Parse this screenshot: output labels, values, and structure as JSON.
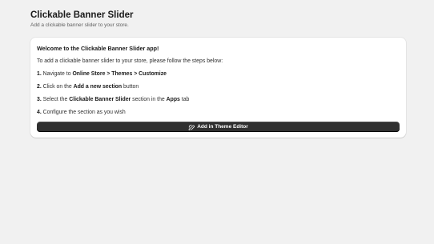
{
  "header": {
    "title": "Clickable Banner Slider",
    "subtitle": "Add a clickable banner slider to your store."
  },
  "card": {
    "welcome": "Welcome to the Clickable Banner Slider app!",
    "intro": "To add a clickable banner slider to your store, please follow the steps below:",
    "steps": [
      {
        "num": "1.",
        "pre": " Navigate to ",
        "bold": "Online Store > Themes > Customize",
        "post": ""
      },
      {
        "num": "2.",
        "pre": " Click on the ",
        "bold": "Add a new section",
        "post": " button"
      },
      {
        "num": "3.",
        "pre": " Select the ",
        "bold": "Clickable Banner Slider",
        "post": " section in the ",
        "bold2": "Apps",
        "post2": " tab"
      },
      {
        "num": "4.",
        "pre": " Configure the section as you wish"
      }
    ],
    "cta": {
      "label": "Add in Theme Editor",
      "icon": "theme-editor-icon"
    }
  },
  "colors": {
    "background": "#f1f1f1",
    "card": "#ffffff",
    "button": "#303030"
  }
}
